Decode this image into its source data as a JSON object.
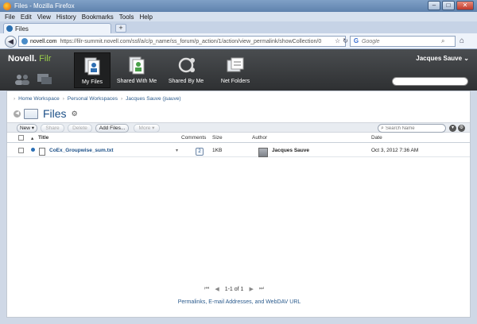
{
  "window": {
    "title": "Files - Mozilla Firefox",
    "min": "–",
    "max": "□",
    "close": "✕"
  },
  "menu": [
    "File",
    "Edit",
    "View",
    "History",
    "Bookmarks",
    "Tools",
    "Help"
  ],
  "tab": {
    "title": "Files",
    "new_tab": "+"
  },
  "nav": {
    "back": "◀",
    "url_domain": "novell.com",
    "url_path": "https://filr-summit.novell.com/ssf/a/c/p_name/ss_forum/p_action/1/action/view_permalink/showCollection/0",
    "star": "☆",
    "reload": "↻",
    "search_placeholder": "Google",
    "home": "⌂"
  },
  "filr": {
    "logo_novell": "Novell.",
    "logo_filr": "Filr",
    "user": "Jacques Sauve ⌄",
    "tiles": [
      {
        "label": "My Files"
      },
      {
        "label": "Shared With Me"
      },
      {
        "label": "Shared By Me"
      },
      {
        "label": "Net Folders"
      }
    ]
  },
  "breadcrumb": [
    "Home Workspace",
    "Personal Workspaces",
    "Jacques Sauve (jsauve)"
  ],
  "page": {
    "title": "Files"
  },
  "toolbar": {
    "new": "New ▾",
    "share": "Share",
    "delete": "Delete",
    "add_files": "Add Files...",
    "more": "More ▾",
    "search_placeholder": "Search Name"
  },
  "table": {
    "headers": {
      "title": "Title",
      "comments": "Comments",
      "size": "Size",
      "author": "Author",
      "date": "Date"
    },
    "rows": [
      {
        "title": "CoEx_Groupwise_sum.txt",
        "comments": "2",
        "size": "1KB",
        "author": "Jacques Sauve",
        "date": "Oct 3, 2012 7:36 AM"
      }
    ]
  },
  "pager": {
    "text": "1-1 of 1"
  },
  "footer": {
    "permalinks": "Permalinks, E-mail Addresses, and WebDAV URL"
  },
  "colors": {
    "header_bg": "#3a3c3e",
    "filr_green": "#9bd04a",
    "link_blue": "#1b4f87"
  }
}
